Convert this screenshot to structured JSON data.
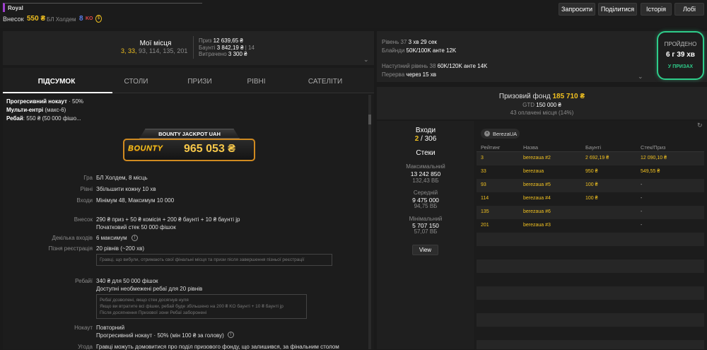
{
  "header": {
    "room_name": "Royal",
    "buyin_label": "Внесок",
    "buyin_value": "550 ₴",
    "game_label": "БЛ Холдем",
    "num_8": "8",
    "ko_badge": "KO",
    "buttons": {
      "request": "Запросити",
      "share": "Поділитися",
      "history": "Історія",
      "lobby": "Лобі"
    }
  },
  "places": {
    "title": "Мої місця",
    "highlight": "3, 33,",
    "rest": "93, 114, 135, 201",
    "prize_label": "Приз",
    "prize_value": "12 639,65 ₴",
    "bounty_label": "Баунті",
    "bounty_value": "3 842,19 ₴",
    "bounty_count": "| 14",
    "spent_label": "Витрачено",
    "spent_value": "3 300 ₴"
  },
  "level": {
    "current_label": "Рівень 37",
    "current_time": "3 хв 29 сек",
    "blinds_label": "Блайнди",
    "blinds_value": "50K/100K анте 12K",
    "next_label": "Наступний рівень 38",
    "next_value": "60K/120K анте 14K",
    "break_label": "Перерва",
    "break_value": "через 15 хв"
  },
  "status": {
    "title": "ПРОЙДЕНО",
    "time": "6 г 39 хв",
    "sub": "У ПРИЗАХ"
  },
  "tabs": [
    "ПІДСУМОК",
    "СТОЛИ",
    "ПРИЗИ",
    "РІВНІ",
    "САТЕЛІТИ"
  ],
  "summary": {
    "pko_label": "Прогресивний нокаут",
    "pko_value": "· 50%",
    "multi_label": "Мульти-ентрі",
    "multi_value": "(макс-6)",
    "rebuy_label": "Ребай",
    "rebuy_value": ": 550 ₴ (50 000 фішо..."
  },
  "jackpot": {
    "title": "BOUNTY JACKPOT UAH",
    "logo": "BOUNTY",
    "amount": "965 053 ₴"
  },
  "details": {
    "game_label": "Гра",
    "game_value": "БЛ Холдем, 8 місць",
    "levels_label": "Рівні",
    "levels_value": "Збільшити кожну 10 хв",
    "entries_label": "Входи",
    "entries_value": "Мінімум 48, Максимум 10 000",
    "fee_label": "Внесок",
    "fee_value1": "290 ₴ приз + 50 ₴ комісія + 200 ₴ баунті + 10 ₴ баунті jp",
    "fee_value2": "Початковий стек 50 000 фішок",
    "multi_label": "Декілька входів",
    "multi_value": "6 максимум",
    "late_label": "Пізня реєстрація",
    "late_value": "20 рівнів (~200 хв)",
    "late_note": "Гравці, що вибули, отримають свої фінальні місця та призи після завершення пізньої реєстрації",
    "rebuy_label": "Ребайї",
    "rebuy_value1": "340 ₴ для 50 000 фішок",
    "rebuy_value2": "Доступні необмежені ребаї для 20 рівнів",
    "rebuy_note1": "Ребаї дозволені, якщо стек досягнув нуля",
    "rebuy_note2": "Якщо ви втратите всі фішки, ребай буде збільшено на 200 ₴ KO баунті + 10 ₴ баунті jp",
    "rebuy_note3": "Після досягнення Призової зони Ребаї заборонені",
    "knock_label": "Нокаут",
    "knock_value1": "Повторний",
    "knock_value2": "Прогресивний нокаут · 50% (мін 100 ₴ за голову)",
    "deal_label": "Угода",
    "deal_value": "Гравці можуть домовитися про поділ призового фонду, що залишився, за фінальним столом"
  },
  "prizepool": {
    "label": "Призовий фонд",
    "value": "185 710 ₴",
    "gtd_label": "GTD",
    "gtd_value": "150 000 ₴",
    "paid": "43 оплачені місця (14%)"
  },
  "entries": {
    "title": "Входи",
    "current": "2",
    "total": "/ 306",
    "stacks_title": "Стеки",
    "max_label": "Максимальний",
    "max_value": "13 242 850",
    "max_bb": "132,43 ВБ",
    "avg_label": "Середній",
    "avg_value": "9 475 000",
    "avg_bb": "94,75 ВБ",
    "min_label": "Мінімальний",
    "min_value": "5 707 150",
    "min_bb": "57,07 ВБ",
    "view_button": "View"
  },
  "table": {
    "filter_chip": "BerezaUA",
    "headers": [
      "Рейтинг",
      "Назва",
      "Баунті",
      "Стек/Приз"
    ],
    "rows": [
      {
        "rank": "3",
        "name": "berezaua #2",
        "bounty": "2 692,19 ₴",
        "stack": "12 090,10 ₴"
      },
      {
        "rank": "33",
        "name": "berezaua",
        "bounty": "950 ₴",
        "stack": "549,55 ₴"
      },
      {
        "rank": "93",
        "name": "berezaua #5",
        "bounty": "100 ₴",
        "stack": "-"
      },
      {
        "rank": "114",
        "name": "berezaua #4",
        "bounty": "100 ₴",
        "stack": "-"
      },
      {
        "rank": "135",
        "name": "berezaua #6",
        "bounty": "",
        "stack": "-"
      },
      {
        "rank": "201",
        "name": "berezaua #3",
        "bounty": "",
        "stack": "-"
      }
    ]
  },
  "colors": {
    "accent": "#f0c020",
    "status_border": "#2ecc8a",
    "status_sub": "#2ecc8a",
    "ko_red": "#e04848",
    "num_blue": "#5a7de8"
  }
}
